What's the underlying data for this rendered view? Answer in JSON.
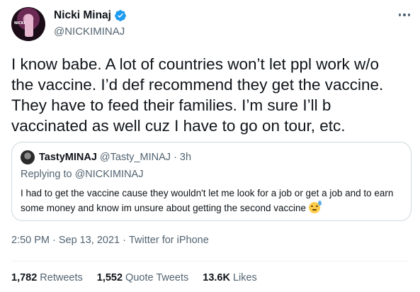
{
  "author": {
    "display_name": "Nicki Minaj",
    "handle": "@NICKIMINAJ",
    "verified_icon": "verified-badge-icon",
    "avatar_text": "NICKI"
  },
  "more_icon": "more-options-icon",
  "tweet": {
    "text": "I know babe. A lot of countries won’t let ppl work w/o\nthe vaccine. I’d def recommend they get the vaccine.\nThey have to feed their families. I’m sure I’ll b\nvaccinated as well cuz I have to go on tour, etc."
  },
  "quoted_tweet": {
    "display_name": "TastyMINAJ",
    "handle": "@Tasty_MINAJ",
    "separator": "·",
    "time": "3h",
    "replying_prefix": "Replying to",
    "replying_to": "@NICKIMINAJ",
    "text": "I had to get the vaccine cause they wouldn't let me look for a job or get a job and to earn some money and know im unsure about getting the second vaccine",
    "emoji": "downcast-face-with-sweat-icon"
  },
  "meta": {
    "time": "2:50 PM",
    "sep1": "·",
    "date": "Sep 13, 2021",
    "sep2": "·",
    "source": "Twitter for iPhone"
  },
  "stats": {
    "retweets_count": "1,782",
    "retweets_label": "Retweets",
    "quote_count": "1,552",
    "quote_label": "Quote Tweets",
    "likes_count": "13.6K",
    "likes_label": "Likes"
  },
  "colors": {
    "text": "#0f1419",
    "secondary": "#536471",
    "verified": "#1d9bf0",
    "border": "#cfd9de"
  }
}
